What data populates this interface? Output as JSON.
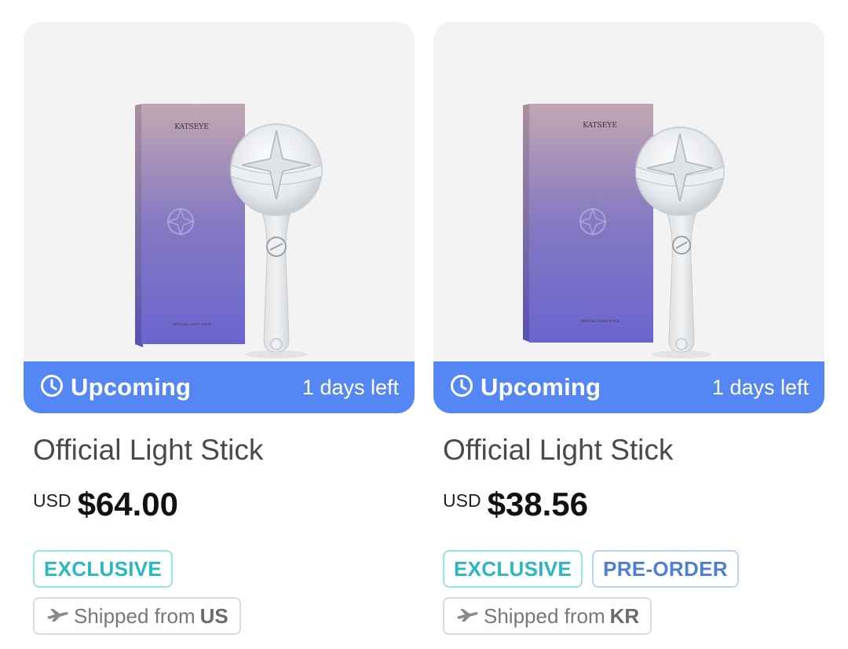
{
  "products": [
    {
      "image_box_text": "KATSEYE",
      "image_box_caption": "OFFICIAL LIGHT STICK",
      "status": "Upcoming",
      "days_left": "1 days left",
      "title": "Official Light Stick",
      "currency": "USD",
      "price": "$64.00",
      "badges": [
        "EXCLUSIVE"
      ],
      "ship_prefix": "Shipped from",
      "ship_origin": "US"
    },
    {
      "image_box_text": "KATSEYE",
      "image_box_caption": "OFFICIAL LIGHT STICK",
      "status": "Upcoming",
      "days_left": "1 days left",
      "title": "Official Light Stick",
      "currency": "USD",
      "price": "$38.56",
      "badges": [
        "EXCLUSIVE",
        "PRE-ORDER"
      ],
      "ship_prefix": "Shipped from",
      "ship_origin": "KR"
    }
  ],
  "colors": {
    "status_bar": "#5587f4",
    "exclusive": "#28b8c2",
    "preorder": "#4d7fd8"
  },
  "icons": {
    "status": "clock-icon",
    "shipping": "airplane-icon"
  }
}
